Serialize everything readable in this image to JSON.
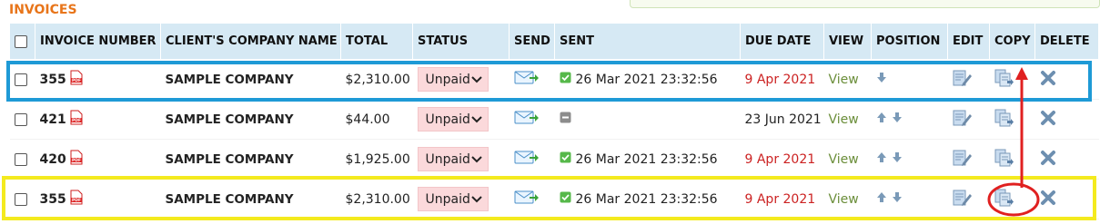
{
  "section_title": "INVOICES",
  "columns": [
    "INVOICE NUMBER",
    "CLIENT'S COMPANY NAME",
    "TOTAL",
    "STATUS",
    "SEND",
    "SENT",
    "DUE DATE",
    "VIEW",
    "POSITION",
    "EDIT",
    "COPY",
    "DELETE"
  ],
  "rows": [
    {
      "invoice": "355",
      "company": "SAMPLE COMPANY",
      "total": "$2,310.00",
      "status": "Unpaid",
      "sent": "26 Mar 2021 23:32:56",
      "sent_icon": "check-icon",
      "due": "9 Apr 2021",
      "due_color": "#cc2222",
      "view": "View",
      "position": [
        "arrow-down-icon"
      ]
    },
    {
      "invoice": "421",
      "company": "SAMPLE COMPANY",
      "total": "$44.00",
      "status": "Unpaid",
      "sent": "",
      "sent_icon": "not-sent-icon",
      "due": "23 Jun 2021",
      "due_color": "#222222",
      "view": "View",
      "position": [
        "arrow-up-icon",
        "arrow-down-icon"
      ]
    },
    {
      "invoice": "420",
      "company": "SAMPLE COMPANY",
      "total": "$1,925.00",
      "status": "Unpaid",
      "sent": "26 Mar 2021 23:32:56",
      "sent_icon": "check-icon",
      "due": "9 Apr 2021",
      "due_color": "#cc2222",
      "view": "View",
      "position": [
        "arrow-up-icon",
        "arrow-down-icon"
      ]
    },
    {
      "invoice": "355",
      "company": "SAMPLE COMPANY",
      "total": "$2,310.00",
      "status": "Unpaid",
      "sent": "26 Mar 2021 23:32:56",
      "sent_icon": "check-icon",
      "due": "9 Apr 2021",
      "due_color": "#cc2222",
      "view": "View",
      "position": [
        "arrow-up-icon",
        "arrow-down-icon"
      ]
    }
  ],
  "colors": {
    "accent": "#e8751a",
    "header_bg": "#d6e9f4",
    "status_bg": "#fbd9db",
    "view_link": "#6b8e3a",
    "highlight_blue": "#1e9ad6",
    "highlight_yellow": "#f4ea1e",
    "annotation_red": "#e02020"
  }
}
